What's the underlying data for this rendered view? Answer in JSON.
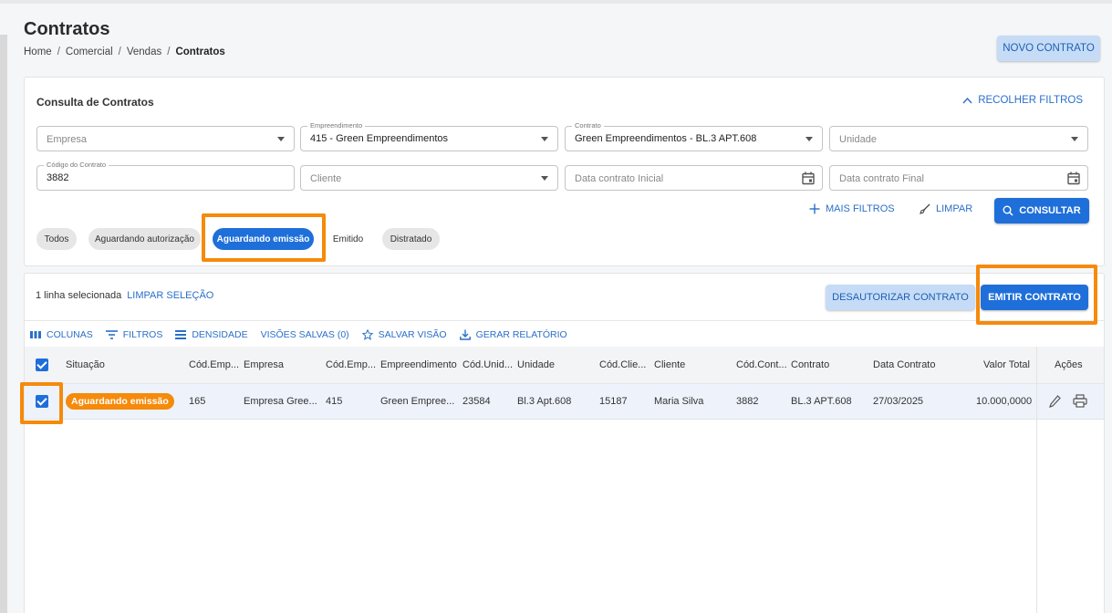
{
  "page": {
    "title": "Contratos",
    "breadcrumb": [
      "Home",
      "Comercial",
      "Vendas",
      "Contratos"
    ],
    "new_button": "NOVO CONTRATO"
  },
  "filters": {
    "title": "Consulta de Contratos",
    "collapse_label": "RECOLHER FILTROS",
    "empresa": {
      "placeholder": "Empresa"
    },
    "empreendimento": {
      "label": "Empreendimento",
      "value": "415 - Green Empreendimentos"
    },
    "contrato": {
      "label": "Contrato",
      "value": "Green Empreendimentos - BL.3 APT.608"
    },
    "unidade": {
      "placeholder": "Unidade"
    },
    "codigo": {
      "label": "Código do Contrato",
      "value": "3882"
    },
    "cliente": {
      "placeholder": "Cliente"
    },
    "data_inicial": {
      "placeholder": "Data contrato Inicial"
    },
    "data_final": {
      "placeholder": "Data contrato Final"
    },
    "more_label": "MAIS FILTROS",
    "clear_label": "LIMPAR",
    "search_label": "CONSULTAR",
    "chips": [
      "Todos",
      "Aguardando autorização",
      "Aguardando emissão",
      "Emitido",
      "Distratado"
    ],
    "active_chip": "Aguardando emissão"
  },
  "table_card": {
    "selection_text": "1 linha selecionada",
    "clear_selection": "LIMPAR SELEÇÃO",
    "unauthorize_button": "DESAUTORIZAR CONTRATO",
    "emit_button": "EMITIR CONTRATO",
    "toolbar": {
      "columns": "COLUNAS",
      "filters": "FILTROS",
      "density": "DENSIDADE",
      "saved_views": "VISÕES SALVAS (0)",
      "save_view": "SALVAR VISÃO",
      "report": "GERAR RELATÓRIO"
    },
    "headers": [
      "Situação",
      "Cód.Emp...",
      "Empresa",
      "Cód.Emp...",
      "Empreendimento",
      "Cód.Unid...",
      "Unidade",
      "Cód.Clie...",
      "Cliente",
      "Cód.Cont...",
      "Contrato",
      "Data Contrato",
      "Valor Total",
      "Ações"
    ],
    "rows": [
      {
        "situacao": "Aguardando emissão",
        "cod_empresa": "165",
        "empresa": "Empresa Gree...",
        "cod_empreendimento": "415",
        "empreendimento": "Green Empree...",
        "cod_unidade": "23584",
        "unidade": "Bl.3 Apt.608",
        "cod_cliente": "15187",
        "cliente": "Maria Silva",
        "cod_contrato": "3882",
        "contrato": "BL.3 APT.608",
        "data_contrato": "27/03/2025",
        "valor_total": "10.000,0000"
      }
    ]
  },
  "colors": {
    "primary": "#1e6fd9",
    "light_primary": "#c6dcf6",
    "highlight": "#f58a0b"
  }
}
